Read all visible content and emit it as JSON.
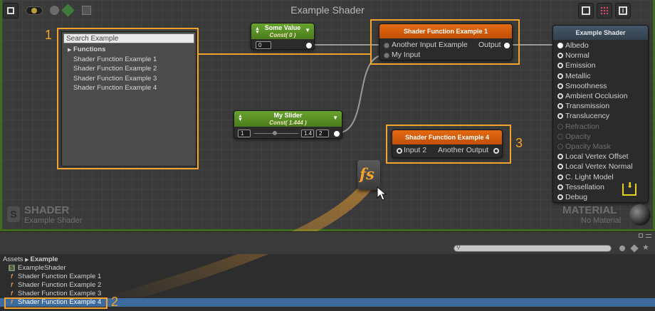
{
  "graph": {
    "title": "Example Shader"
  },
  "search": {
    "placeholder": "Search Example",
    "folder": "Functions",
    "items": [
      "Shader Function Example 1",
      "Shader Function Example 2",
      "Shader Function Example 3",
      "Shader Function Example 4"
    ]
  },
  "nodes": {
    "some_value": {
      "title": "Some Value",
      "subtitle": "Const( 0 )",
      "value": "0"
    },
    "my_slider": {
      "title": "My Slider",
      "subtitle": "Const( 1.444 )",
      "min": "1",
      "value": "1.4",
      "max": "2"
    },
    "func1": {
      "title": "Shader Function Example 1",
      "input1": "Another Input Example",
      "input2": "My Input",
      "output": "Output"
    },
    "func4": {
      "title": "Shader Function Example 4",
      "input": "Input 2",
      "output": "Another Output"
    },
    "master": {
      "title": "Example Shader",
      "ports": [
        "Albedo",
        "Normal",
        "Emission",
        "Metallic",
        "Smoothness",
        "Ambient Occlusion",
        "Transmission",
        "Translucency",
        "Refraction",
        "Opacity",
        "Opacity Mask",
        "Local Vertex Offset",
        "Local Vertex Normal",
        "C. Light Model",
        "Tessellation",
        "Debug"
      ],
      "dimmed": [
        false,
        false,
        false,
        false,
        false,
        false,
        false,
        false,
        true,
        true,
        true,
        false,
        false,
        false,
        false,
        false
      ]
    }
  },
  "watermark": {
    "shader_title": "SHADER",
    "shader_name": "Example Shader",
    "material_title": "MATERIAL",
    "material_name": "No Material"
  },
  "callouts": [
    "1",
    "2",
    "3"
  ],
  "drag_icon": "fs",
  "project": {
    "breadcrumb": [
      "Assets",
      "Example"
    ],
    "files": [
      {
        "name": "ExampleShader",
        "icon": "S",
        "type": "shader"
      },
      {
        "name": "Shader Function Example 1",
        "icon": "f",
        "type": "function"
      },
      {
        "name": "Shader Function Example 2",
        "icon": "f",
        "type": "function"
      },
      {
        "name": "Shader Function Example 3",
        "icon": "f",
        "type": "function"
      },
      {
        "name": "Shader Function Example 4",
        "icon": "f",
        "type": "function",
        "selected": true
      }
    ]
  },
  "colors": {
    "accent": "#f3a32c",
    "selection": "#3d6b9e",
    "green_header": "#5a8f25",
    "orange_header": "#d25c0b"
  }
}
